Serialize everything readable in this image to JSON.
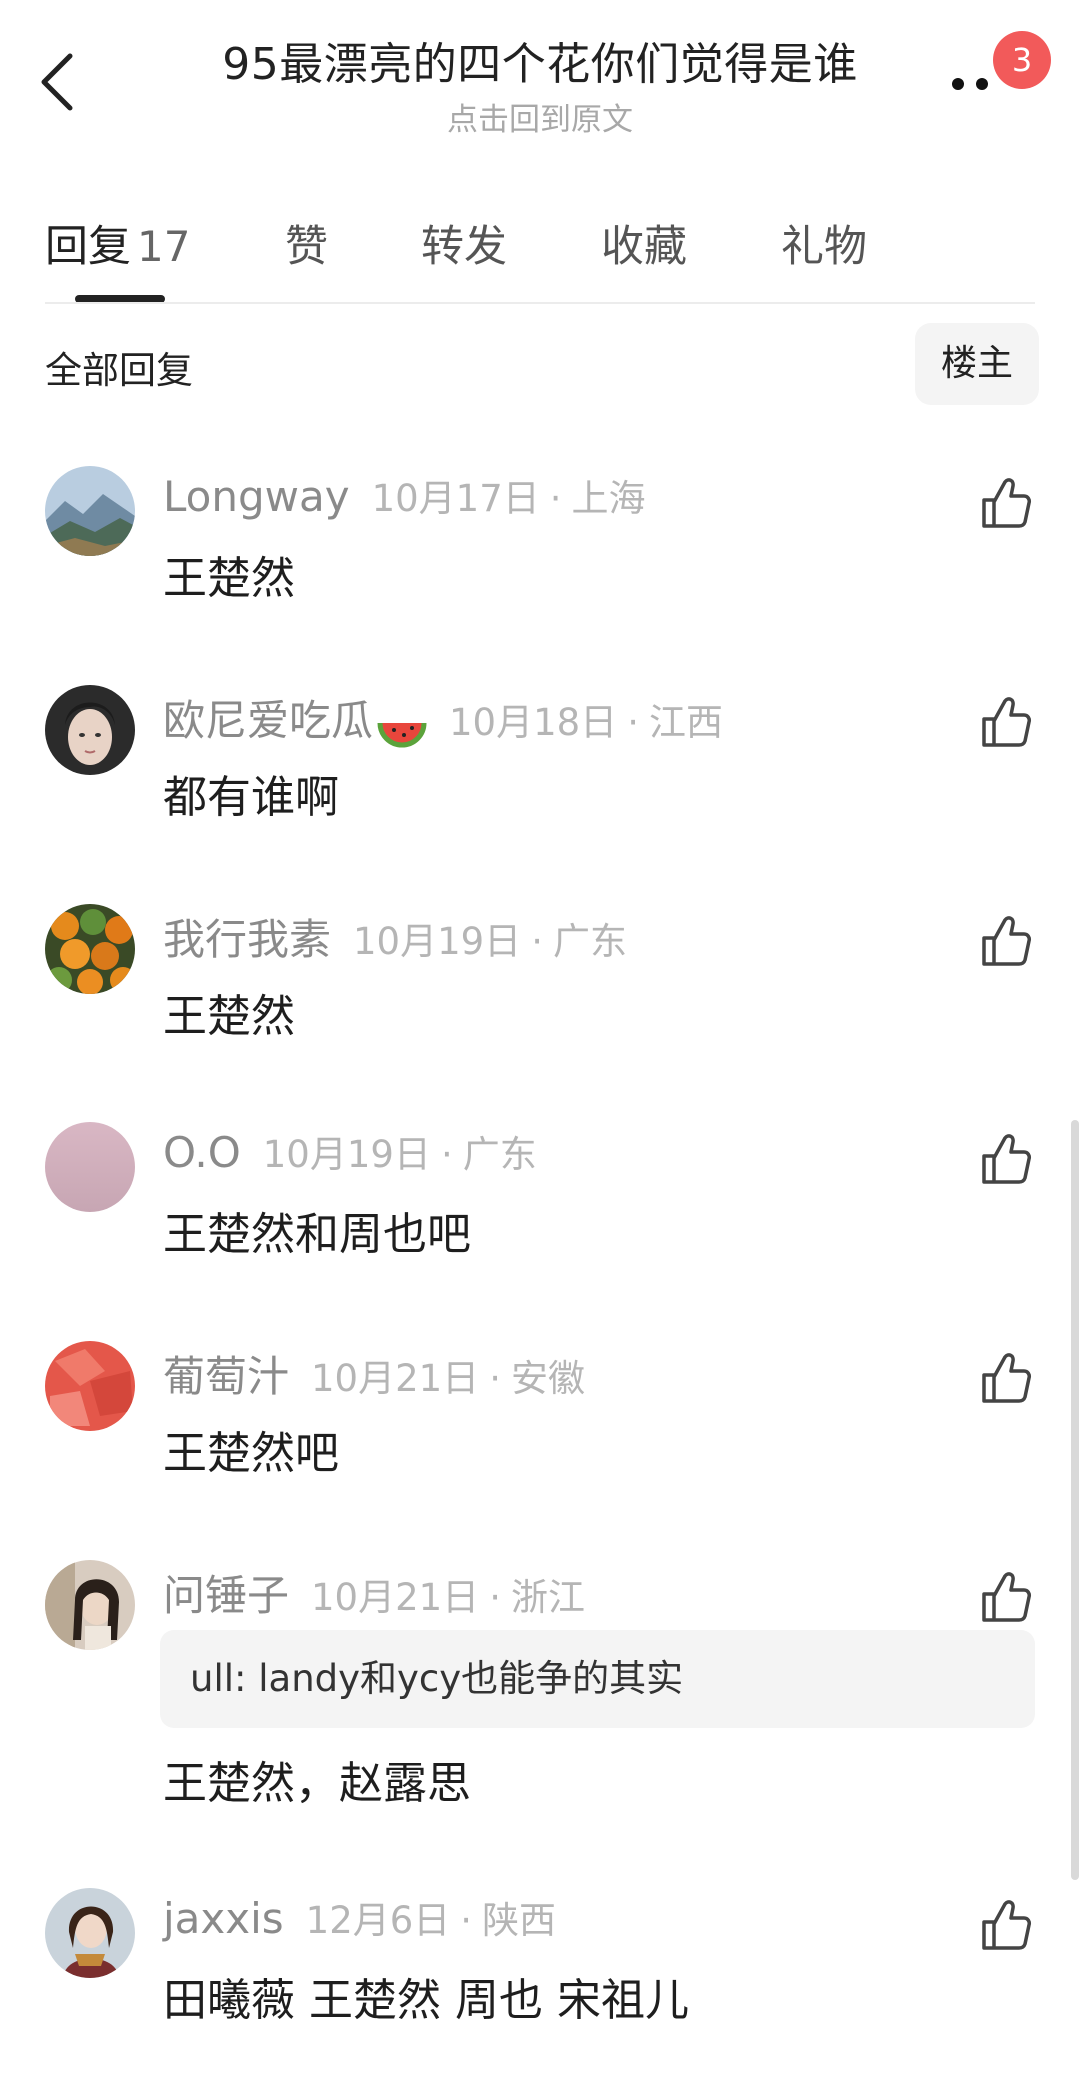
{
  "header": {
    "title": "95最漂亮的四个花你们觉得是谁",
    "subtitle": "点击回到原文",
    "badge_count": "3"
  },
  "tabs": [
    {
      "label": "回复",
      "count": "17",
      "active": true
    },
    {
      "label": "赞"
    },
    {
      "label": "转发"
    },
    {
      "label": "收藏"
    },
    {
      "label": "礼物"
    }
  ],
  "section": {
    "title": "全部回复",
    "filter_button": "楼主"
  },
  "separator": "·",
  "comments": [
    {
      "name": "Longway",
      "date": "10月17日",
      "location": "上海",
      "text": "王楚然",
      "avatar_icon": "mountain-avatar-icon"
    },
    {
      "name": "欧尼爱吃瓜",
      "emoji_icon": "watermelon-icon",
      "date": "10月18日",
      "location": "江西",
      "text": "都有谁啊",
      "avatar_icon": "portrait-avatar-icon"
    },
    {
      "name": "我行我素",
      "date": "10月19日",
      "location": "广东",
      "text": "王楚然",
      "avatar_icon": "oranges-avatar-icon"
    },
    {
      "name": "O.O",
      "date": "10月19日",
      "location": "广东",
      "text": "王楚然和周也吧",
      "avatar_icon": "pink-sky-avatar-icon"
    },
    {
      "name": "葡萄汁",
      "date": "10月21日",
      "location": "安徽",
      "text": "王楚然吧",
      "avatar_icon": "red-fruit-avatar-icon"
    },
    {
      "name": "问锤子",
      "date": "10月21日",
      "location": "浙江",
      "quote": "ull: landy和ycy也能争的其实",
      "text": "王楚然，赵露思",
      "avatar_icon": "girl-avatar-icon"
    },
    {
      "name": "jaxxis",
      "date": "12月6日",
      "location": "陕西",
      "text": "田曦薇 王楚然 周也 宋祖儿",
      "avatar_icon": "woman-avatar-icon"
    }
  ],
  "colors": {
    "badge": "#f25a5a",
    "name_text": "#8a8a8a",
    "meta_text": "#b5b5b5",
    "quote_bg": "#f4f4f4"
  }
}
